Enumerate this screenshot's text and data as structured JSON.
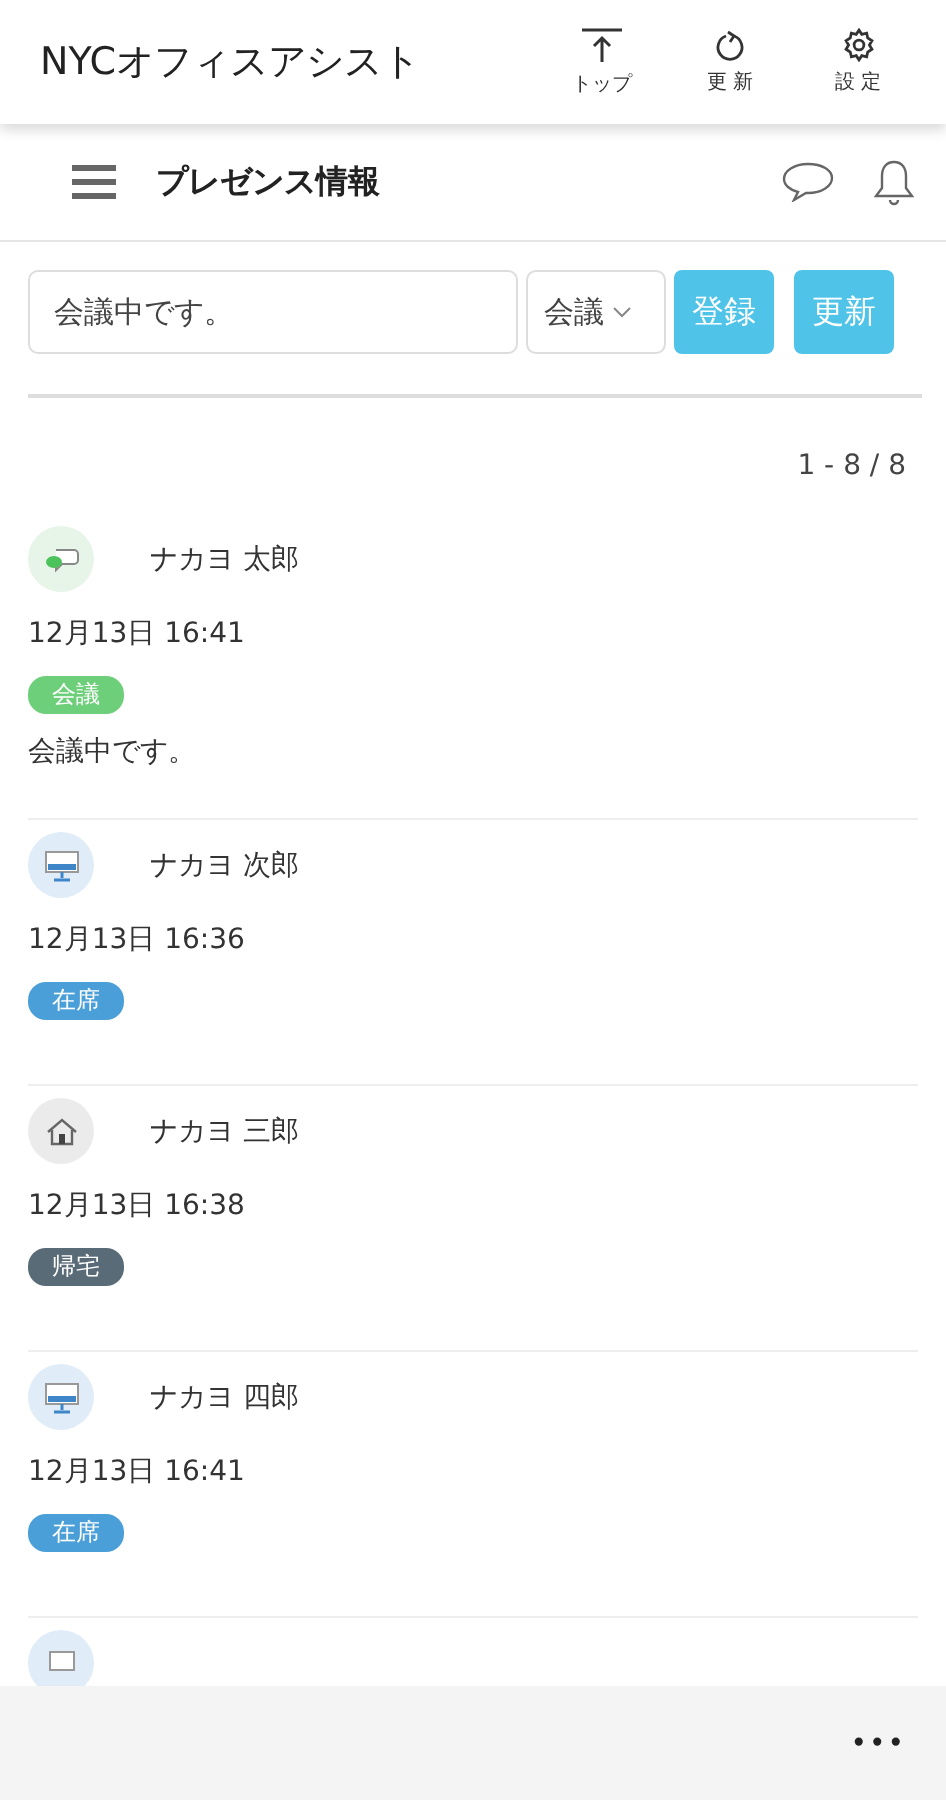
{
  "app_bar": {
    "title": "NYCオフィスアシスト",
    "actions": [
      {
        "kind": "top",
        "label": "トップ"
      },
      {
        "kind": "refresh",
        "label": "更 新"
      },
      {
        "kind": "settings",
        "label": "設 定"
      }
    ]
  },
  "sub_bar": {
    "title": "プレゼンス情報"
  },
  "form": {
    "message": "会議中です。",
    "status": "会議",
    "buttons": [
      "登録",
      "更新"
    ]
  },
  "count": "1 - 8 / 8",
  "entries": [
    {
      "kind": "chat",
      "name": "ナカヨ 太郎",
      "time": "12月13日 16:41",
      "status": {
        "label": "会議",
        "color": "#6dcf7a"
      },
      "message": "会議中です。"
    },
    {
      "kind": "monitor",
      "name": "ナカヨ 次郎",
      "time": "12月13日 16:36",
      "status": {
        "label": "在席",
        "color": "#4a9fd8"
      }
    },
    {
      "kind": "home",
      "name": "ナカヨ 三郎",
      "time": "12月13日 16:38",
      "status": {
        "label": "帰宅",
        "color": "#5a6b78"
      }
    },
    {
      "kind": "monitor",
      "name": "ナカヨ 四郎",
      "time": "12月13日 16:41",
      "status": {
        "label": "在席",
        "color": "#4a9fd8"
      }
    },
    {
      "kind": "laptop"
    }
  ],
  "bottom_bar": {
    "more": "•••"
  }
}
